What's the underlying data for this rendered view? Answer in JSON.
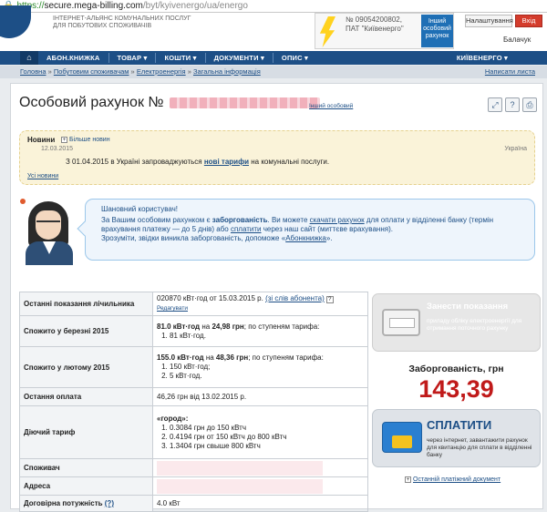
{
  "browser": {
    "protocol": "https://",
    "host": "secure.mega-billing.com",
    "path": "/byt/kyivenergo/ua/energo"
  },
  "header": {
    "desc_line1": "ІНТЕРНЕТ-АЛЬЯНС КОМУНАЛЬНИХ ПОСЛУГ",
    "desc_line2": "ДЛЯ ПОБУТОВИХ СПОЖИВАЧІВ",
    "account_num": "№ 09054200802,",
    "provider_name": "ПАТ \"Київенерго\"",
    "other_provider": "Інший особовий рахунок",
    "settings_label": "Налаштування",
    "exit_label": "Вхід",
    "user_name": "Балачук"
  },
  "nav": {
    "home_icon": "home-icon",
    "items": [
      "АБОН.КНИЖКА",
      "ТОВАР",
      "КОШТИ",
      "ДОКУМЕНТИ",
      "ОПИС"
    ],
    "right": "КИЇВЕНЕРГО"
  },
  "breadcrumb": {
    "items": [
      "Головна",
      "Побутовим споживачам",
      "Електроенергія",
      "Загальна інформація"
    ],
    "write": "Написати листа"
  },
  "title": {
    "prefix": "Особовий рахунок №",
    "link": "Інший особовий"
  },
  "news": {
    "heading": "Новини",
    "more": "Більше новин",
    "date": "12.03.2015",
    "country": "Україна",
    "text_before": "З 01.04.2015 в Україні запроваджуються ",
    "text_link": "нові тарифи",
    "text_after": " на комунальні послуги.",
    "all": "Усі новини"
  },
  "message": {
    "greeting": "Шановний користувач!",
    "line1_a": "За Вашим особовим рахунком є ",
    "line1_b": "заборгованість",
    "line1_c": ". Ви можете ",
    "line1_link": "скачати рахунок",
    "line1_d": " для оплати у відділенні банку (термін",
    "line2_a": "врахування платежу — до 5 днів) або ",
    "line2_link": "сплатити",
    "line2_b": " через наш сайт (миттєве врахування).",
    "line3_a": "Зрозуміти, звідки виникла заборгованість, допоможе «",
    "line3_link": "Абонкнижка",
    "line3_b": "»."
  },
  "rows": {
    "r1_label": "Останні показання лічильника",
    "r1_value": "020870 кВт·год от 15.03.2015 р.",
    "r1_link": "(зі слів абонента)",
    "r1_edit": "Редагувати",
    "r2_label": "Спожито у березні 2015",
    "r2_amount": "81.0 кВт·год",
    "r2_mid": " на ",
    "r2_price": "24,98 грн",
    "r2_tail": "; по ступеням тарифа:",
    "r2_items": [
      "81 кВт·год."
    ],
    "r3_label": "Спожито у лютому 2015",
    "r3_amount": "155.0 кВт·год",
    "r3_mid": " на ",
    "r3_price": "48,36 грн",
    "r3_tail": "; по ступеням тарифа:",
    "r3_items": [
      "150 кВт·год;",
      "5 кВт·год."
    ],
    "r4_label": "Остання оплата",
    "r4_value": "46,26 грн від 13.02.2015 р.",
    "r5_label": "Діючий тариф",
    "r5_head": "«город»:",
    "r5_items": [
      "0.3084 грн до 150 кВтч",
      "0.4194 грн от 150 кВтч до 800 кВтч",
      "1.3404 грн свыше 800 кВтч"
    ],
    "r6_label": "Споживач",
    "r7_label": "Адреса",
    "r8_label": "Договірна потужність",
    "r8_q": "(?)",
    "r8_value": "4.0 кВт"
  },
  "actions": {
    "meter_title": "Занести показання",
    "meter_desc": "приладу обліку електроенергії для отримання поточного рахунку",
    "debt_label": "Заборгованість, грн",
    "debt_value": "143,39",
    "pay_title": "СПЛАТИТИ",
    "pay_desc": "через інтернет, завантажити рахунок для квитанцію для сплати в відділенні банку",
    "last_doc": "Останній платіжний документ"
  },
  "colors": {
    "brand": "#1d4f86",
    "debt": "#c01a1a",
    "news_bg": "#faf3d9",
    "bubble_bg": "#eef5fc"
  }
}
